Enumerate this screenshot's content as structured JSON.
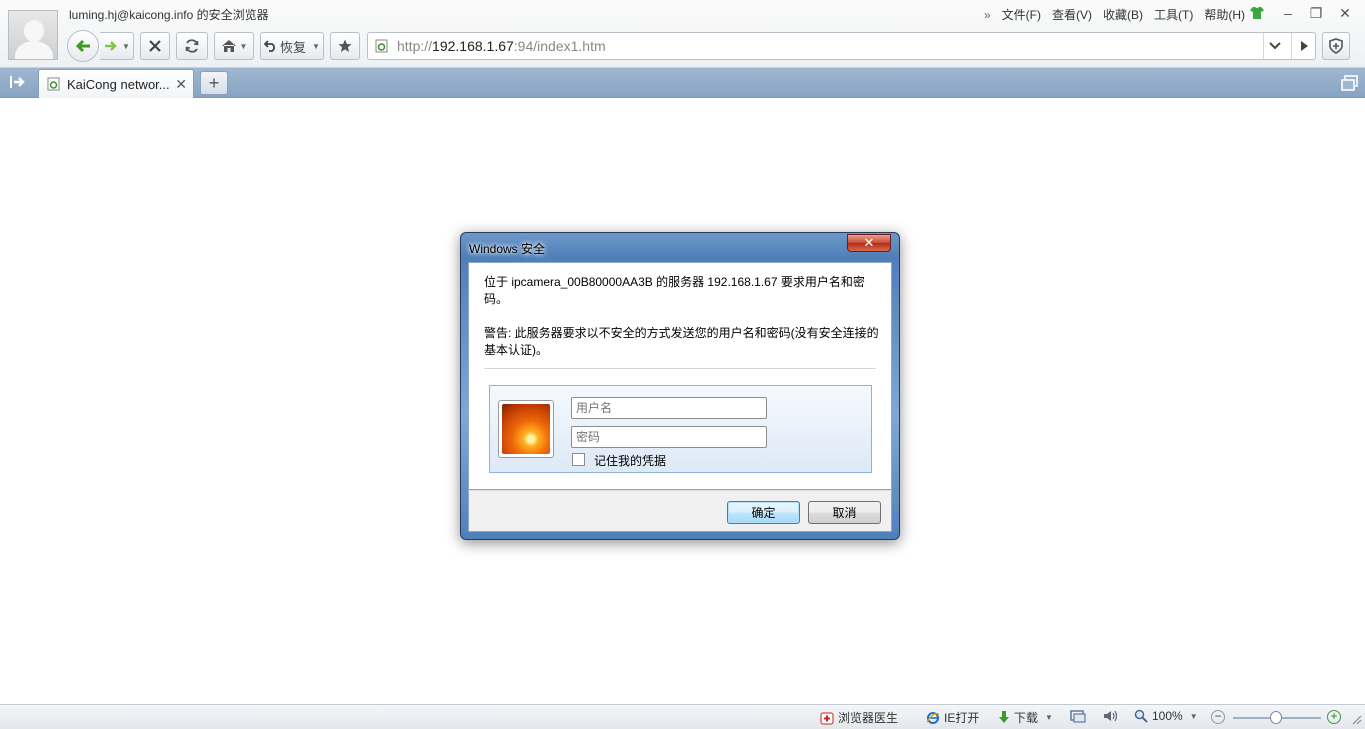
{
  "window": {
    "user_title": "luming.hj@kaicong.info 的安全浏览器"
  },
  "menu": {
    "items": [
      "文件(F)",
      "查看(V)",
      "收藏(B)",
      "工具(T)",
      "帮助(H)"
    ]
  },
  "toolbar": {
    "restore_label": "恢复"
  },
  "address": {
    "url_scheme": "http://",
    "url_host": "192.168.1.67",
    "url_rest": ":94/index1.htm"
  },
  "tabs": [
    {
      "label": "KaiCong networ..."
    }
  ],
  "dialog": {
    "title": "Windows 安全",
    "message": "位于 ipcamera_00B80000AA3B 的服务器 192.168.1.67 要求用户名和密码。",
    "warning": "警告: 此服务器要求以不安全的方式发送您的用户名和密码(没有安全连接的基本认证)。",
    "username_placeholder": "用户名",
    "password_placeholder": "密码",
    "remember_label": "记住我的凭据",
    "remember_checked": false,
    "ok_label": "确定",
    "cancel_label": "取消"
  },
  "status": {
    "doctor_label": "浏览器医生",
    "ie_label": "IE打开",
    "download_label": "下载",
    "zoom_label": "100%",
    "zoom_level": 1.0
  },
  "colors": {
    "tab_bar": "#9fb7d1",
    "dialog_frame": "#4f7fb9",
    "close_red": "#c64a33"
  }
}
